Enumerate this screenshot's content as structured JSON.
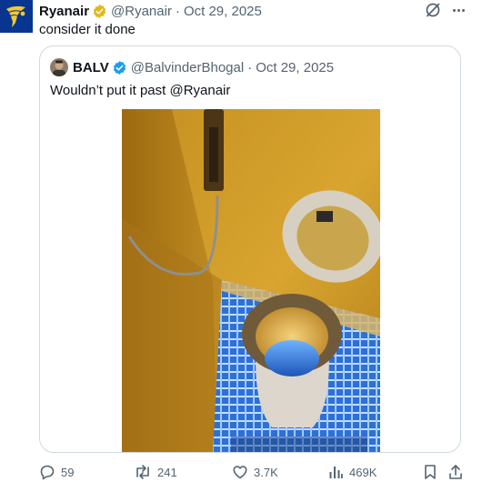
{
  "tweet": {
    "author_name": "Ryanair",
    "author_handle": "@Ryanair",
    "separator": "·",
    "date": "Oct 29, 2025",
    "text": "consider it done"
  },
  "quote": {
    "author_name": "BALV",
    "author_handle": "@BalvinderBhogal",
    "separator": "·",
    "date": "Oct 29, 2025",
    "text": "Wouldn’t put it past @Ryanair"
  },
  "actions": {
    "replies": "59",
    "reposts": "241",
    "likes": "3.7K",
    "views": "469K"
  },
  "icons": [
    "ryanair-harp-logo",
    "verified-gold-badge",
    "grok-icon",
    "more-icon",
    "verified-blue-badge",
    "reply-icon",
    "repost-icon",
    "like-icon",
    "views-icon",
    "bookmark-icon",
    "share-icon"
  ],
  "colors": {
    "brand_blue": "#073590",
    "brand_yellow": "#f1c933",
    "gold_badge": "#e2b719",
    "blue_badge": "#1d9bf0",
    "muted": "#536471"
  }
}
